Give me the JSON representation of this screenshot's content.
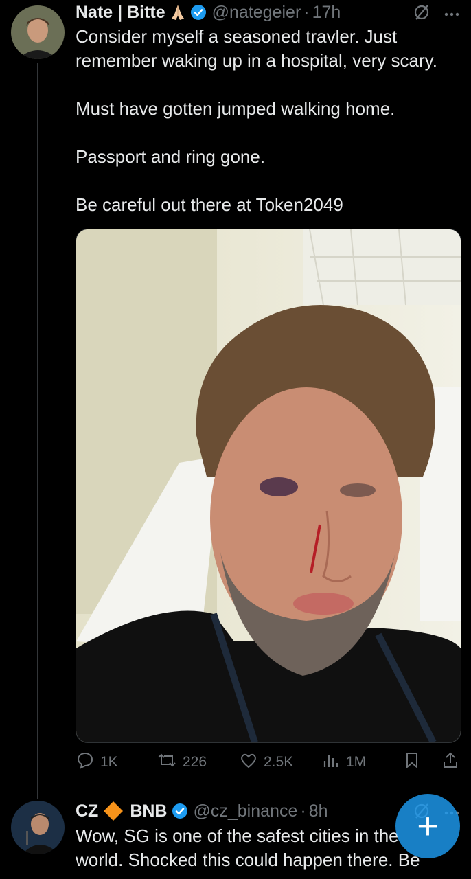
{
  "tweet1": {
    "name": "Nate | Bitte",
    "handle": "@nategeier",
    "time": "17h",
    "paragraphs": [
      "Consider myself a seasoned travler. Just remember waking up in a hospital, very scary.",
      "Must have gotten jumped walking home.",
      "Passport and ring gone.",
      "Be careful out there at Token2049"
    ],
    "stats": {
      "replies": "1K",
      "reposts": "226",
      "likes": "2.5K",
      "views": "1M"
    }
  },
  "tweet2": {
    "name_part1": "CZ",
    "name_part2": "BNB",
    "handle": "@cz_binance",
    "time": "8h",
    "text_line1": "Wow, SG is one of the safest cities in the",
    "text_line2": "world. Shocked this could happen there. Be"
  },
  "fab": {
    "label": "+"
  },
  "separator": "·",
  "icons": {
    "verified": "verified-badge-icon",
    "grok": "grok-icon",
    "more": "more-icon",
    "reply": "reply-icon",
    "repost": "repost-icon",
    "like": "like-icon",
    "views": "views-icon",
    "bookmark": "bookmark-icon",
    "share": "share-icon"
  },
  "colors": {
    "accent": "#1d9bf0",
    "muted": "#71767b",
    "text": "#e7e9ea",
    "background": "#000000"
  }
}
